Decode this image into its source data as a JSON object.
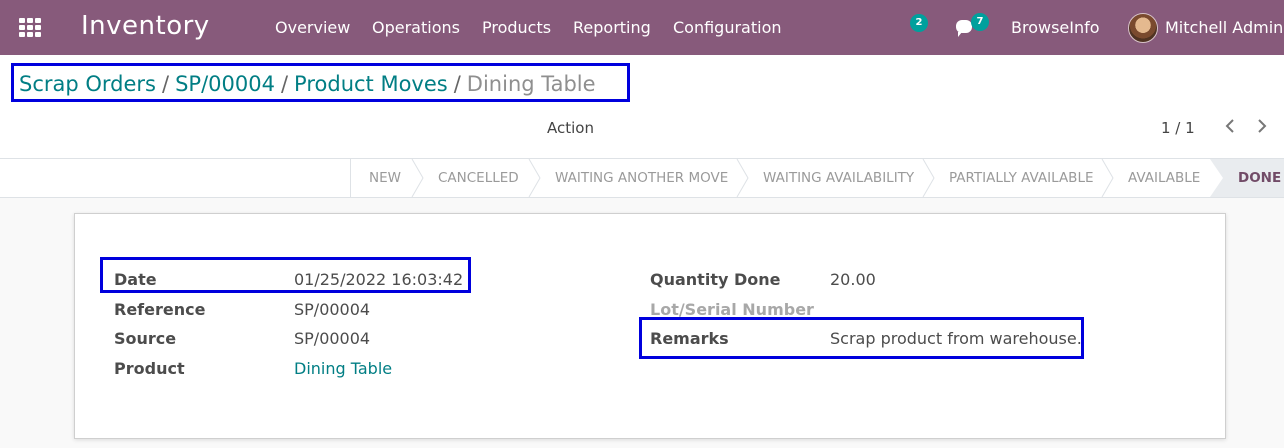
{
  "navbar": {
    "app_title": "Inventory",
    "menu": [
      "Overview",
      "Operations",
      "Products",
      "Reporting",
      "Configuration"
    ],
    "activity_count": "2",
    "message_count": "7",
    "company": "BrowseInfo",
    "user": "Mitchell Admin"
  },
  "breadcrumb": {
    "items": [
      "Scrap Orders",
      "SP/00004",
      "Product Moves"
    ],
    "separator": "/",
    "current": "Dining Table"
  },
  "control": {
    "action_label": "Action",
    "pager": "1 / 1"
  },
  "statusbar": {
    "stages": [
      "NEW",
      "CANCELLED",
      "WAITING ANOTHER MOVE",
      "WAITING AVAILABILITY",
      "PARTIALLY AVAILABLE",
      "AVAILABLE",
      "DONE"
    ],
    "active": "DONE"
  },
  "form": {
    "left": [
      {
        "label": "Date",
        "value": "01/25/2022 16:03:42"
      },
      {
        "label": "Reference",
        "value": "SP/00004"
      },
      {
        "label": "Source",
        "value": "SP/00004"
      },
      {
        "label": "Product",
        "value": "Dining Table"
      }
    ],
    "right": [
      {
        "label": "Quantity Done",
        "value": "20.00"
      },
      {
        "label": "Lot/Serial Number",
        "value": ""
      },
      {
        "label": "Remarks",
        "value": "Scrap product from warehouse."
      }
    ]
  },
  "colors": {
    "navbar": "#875a7b",
    "link": "#017e84",
    "badge": "#00a09d",
    "highlight": "#0000dd"
  }
}
